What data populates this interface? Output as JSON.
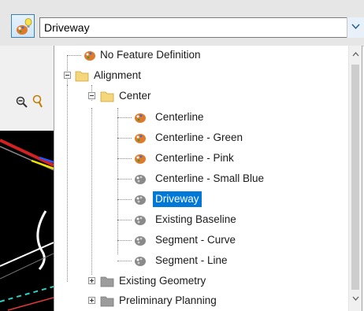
{
  "combo": {
    "selected_value": "Driveway"
  },
  "tree": {
    "items": [
      {
        "label": "No Feature Definition",
        "icon": "feature-palette-icon"
      },
      {
        "label": "Alignment",
        "icon": "folder-icon",
        "expanded": true
      },
      {
        "label": "Center",
        "icon": "folder-icon",
        "expanded": true
      },
      {
        "label": "Centerline",
        "icon": "feature-palette-icon"
      },
      {
        "label": "Centerline - Green",
        "icon": "feature-palette-icon"
      },
      {
        "label": "Centerline - Pink",
        "icon": "feature-palette-icon"
      },
      {
        "label": "Centerline - Small Blue",
        "icon": "feature-palette-gray-icon"
      },
      {
        "label": "Driveway",
        "icon": "feature-palette-gray-icon",
        "selected": true
      },
      {
        "label": "Existing Baseline",
        "icon": "feature-palette-gray-icon"
      },
      {
        "label": "Segment - Curve",
        "icon": "feature-palette-gray-icon"
      },
      {
        "label": "Segment - Line",
        "icon": "feature-palette-gray-icon"
      },
      {
        "label": "Existing Geometry",
        "icon": "folder-gray-icon",
        "expanded": false
      },
      {
        "label": "Preliminary Planning",
        "icon": "folder-gray-icon",
        "expanded": false
      }
    ]
  },
  "colors": {
    "selection": "#0078d7",
    "combo_border": "#7a7a7a",
    "folder": "#f5d67a"
  }
}
